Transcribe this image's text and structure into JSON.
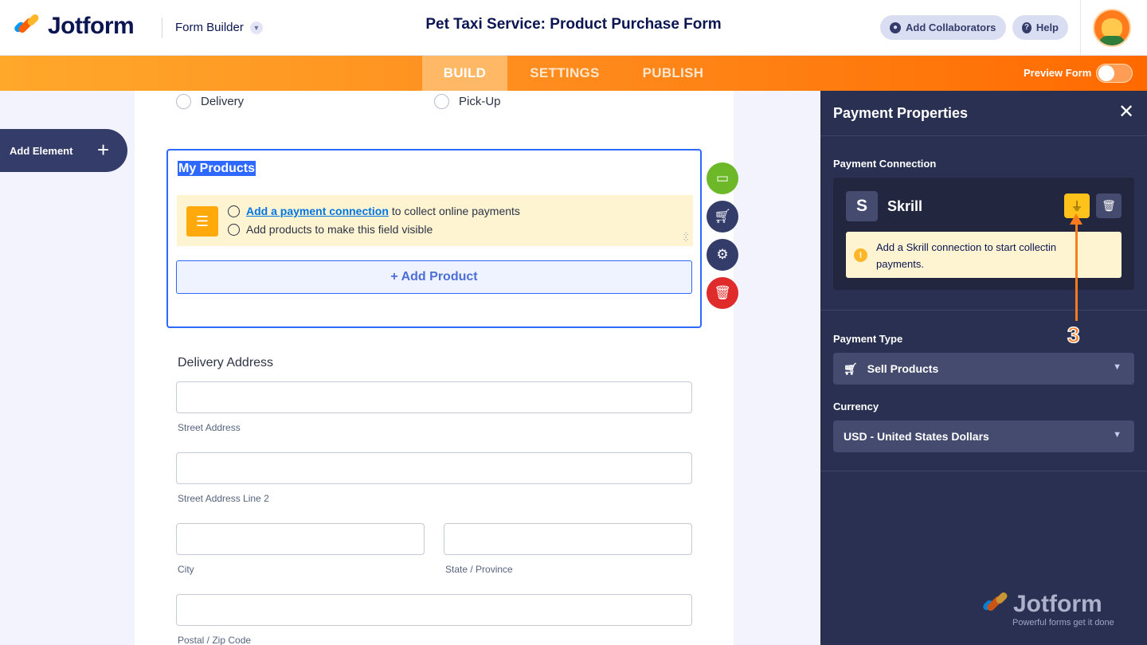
{
  "header": {
    "logo_text": "Jotform",
    "builder_label": "Form Builder",
    "form_title": "Pet Taxi Service: Product Purchase Form",
    "add_collaborators": "Add Collaborators",
    "help": "Help"
  },
  "nav": {
    "tabs": [
      {
        "label": "BUILD",
        "active": true
      },
      {
        "label": "SETTINGS",
        "active": false
      },
      {
        "label": "PUBLISH",
        "active": false
      }
    ],
    "preview_label": "Preview Form",
    "preview_enabled": false
  },
  "sidebar": {
    "add_element": "Add Element"
  },
  "form": {
    "radio_options": [
      "Delivery",
      "Pick-Up"
    ],
    "products_field": {
      "title": "My Products",
      "notice_link": "Add a payment connection",
      "notice_line1_rest": "to collect online payments",
      "notice_line2": "Add products to make this field visible",
      "add_product": "+ Add Product"
    },
    "address": {
      "label": "Delivery Address",
      "sublabels": [
        "Street Address",
        "Street Address Line 2",
        "City",
        "State / Province",
        "Postal / Zip Code"
      ]
    }
  },
  "panel": {
    "title": "Payment Properties",
    "connection_label": "Payment Connection",
    "gateway_letter": "S",
    "gateway_name": "Skrill",
    "warning": "Add a Skrill connection to start collecting payments.",
    "warning_line1": "Add a Skrill connection to start collectin",
    "warning_line2": "payments.",
    "payment_type_label": "Payment Type",
    "payment_type_value": "Sell Products",
    "currency_label": "Currency",
    "currency_value": "USD - United States Dollars",
    "footer_logo": "Jotform",
    "footer_tagline": "Powerful forms get it done"
  },
  "annotation": {
    "step": "3"
  },
  "colors": {
    "accent_orange": "#ff6100",
    "selection_blue": "#2e69ff",
    "panel_bg": "#293051",
    "connect_yellow": "#ffc21b",
    "delete_red": "#e02b2b",
    "payment_green": "#6cb829"
  }
}
